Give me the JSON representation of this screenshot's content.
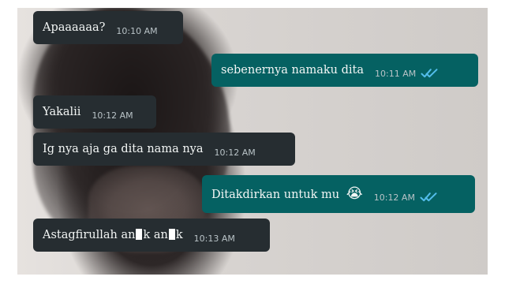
{
  "chat": {
    "messages": [
      {
        "direction": "incoming",
        "text": "Apaaaaaa?",
        "time": "10:10 AM"
      },
      {
        "direction": "outgoing",
        "text": "sebenernya namaku dita",
        "time": "10:11 AM",
        "status_icon": "double-check-read-icon"
      },
      {
        "direction": "incoming",
        "text": "Yakalii",
        "time": "10:12 AM"
      },
      {
        "direction": "incoming",
        "text": "Ig nya aja ga dita nama nya",
        "time": "10:12 AM"
      },
      {
        "direction": "outgoing",
        "text": "Ditakdirkan untuk mu",
        "emoji": "😭",
        "time": "10:12 AM",
        "status_icon": "double-check-read-icon"
      },
      {
        "direction": "incoming",
        "text_parts": [
          "Astagfirullah an",
          "k an",
          "k"
        ],
        "time": "10:13 AM"
      }
    ]
  },
  "colors": {
    "incoming_bubble": "#262d31",
    "outgoing_bubble": "#056162",
    "text": "#f3f6f5",
    "meta_text": "#b9c3c7",
    "read_ticks": "#53bdeb",
    "censor_block": "#ffffff"
  }
}
